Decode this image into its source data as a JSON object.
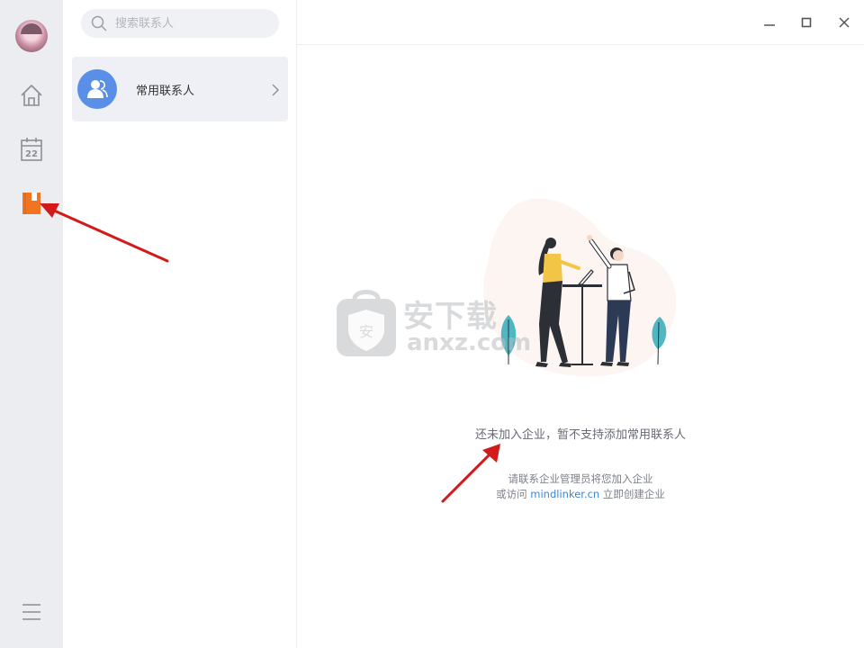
{
  "search": {
    "placeholder": "搜索联系人"
  },
  "contacts": {
    "items": [
      {
        "label": "常用联系人"
      }
    ]
  },
  "sidebar": {
    "items": [
      {
        "name": "home",
        "icon": "home-icon"
      },
      {
        "name": "calendar",
        "icon": "calendar-icon",
        "day": "22"
      },
      {
        "name": "contacts",
        "icon": "contacts-book-icon"
      }
    ]
  },
  "empty_state": {
    "title": "还未加入企业，暂不支持添加常用联系人",
    "hint_line1": "请联系企业管理员将您加入企业",
    "hint_line2_prefix": "或访问 ",
    "hint_link": "mindlinker.cn",
    "hint_line2_suffix": " 立即创建企业"
  },
  "watermark": {
    "cn": "安下载",
    "en": "anxz.com",
    "shield_char": "安"
  },
  "colors": {
    "accent": "#f07422",
    "contact_avatar": "#5a8fe8",
    "link": "#3b86d6",
    "annotation": "#d21a1a"
  }
}
